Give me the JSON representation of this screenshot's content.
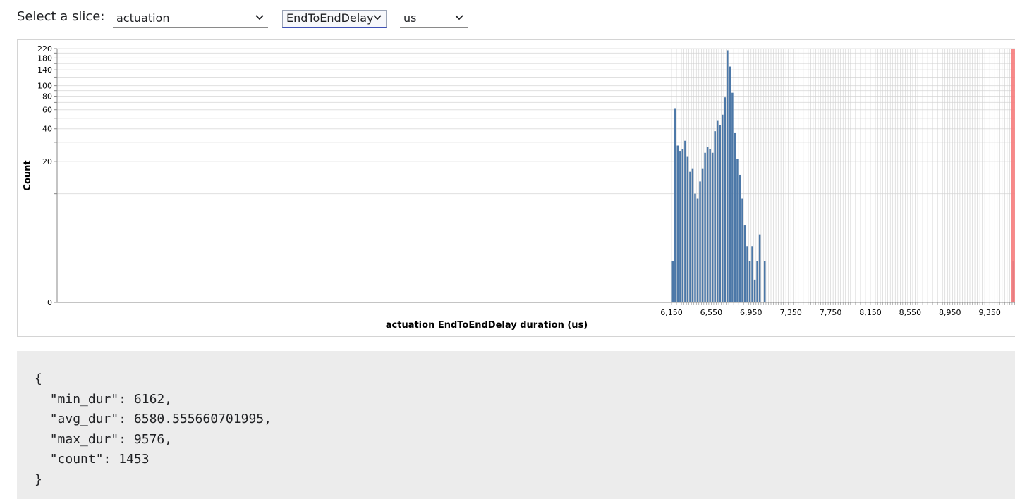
{
  "toolbar": {
    "label": "Select a slice:",
    "slice_select": "actuation",
    "metric_select": "EndToEndDelay",
    "unit_select": "us"
  },
  "stats": {
    "open_brace": "{",
    "lines": [
      "\"min_dur\": 6162,",
      "\"avg_dur\": 6580.555660701995,",
      "\"max_dur\": 9576,",
      "\"count\": 1453"
    ],
    "close_brace": "}"
  },
  "colors": {
    "bar": "#4c78a8",
    "threshold_rule": "#f77c7c",
    "grid": "#e0e0e0",
    "bin_grid": "#cfcfcf"
  },
  "chart_data": {
    "type": "bar",
    "title": "",
    "xlabel": "actuation EndToEndDelay duration (us)",
    "ylabel": "Count",
    "y_scale": "symlog",
    "xlim": [
      6150,
      9600
    ],
    "ylim": [
      0,
      220
    ],
    "x_ticks": [
      "6,150",
      "6,550",
      "6,950",
      "7,350",
      "7,750",
      "8,150",
      "8,550",
      "8,950",
      "9,350"
    ],
    "y_ticks": [
      "0",
      "20",
      "40",
      "60",
      "80",
      "100",
      "140",
      "180",
      "220"
    ],
    "bin_width": 25,
    "bins_start": [
      6150,
      6175,
      6200,
      6225,
      6250,
      6275,
      6300,
      6325,
      6350,
      6375,
      6400,
      6425,
      6450,
      6475,
      6500,
      6525,
      6550,
      6575,
      6600,
      6625,
      6650,
      6675,
      6700,
      6725,
      6750,
      6775,
      6800,
      6825,
      6850,
      6875,
      6900,
      6925,
      6950,
      6975,
      7000,
      7025,
      7050,
      7075,
      9575
    ],
    "counts": [
      2,
      62,
      28,
      25,
      26,
      31,
      22,
      16,
      17,
      10,
      9,
      13,
      17,
      24,
      27,
      26,
      24,
      38,
      48,
      43,
      54,
      78,
      212,
      150,
      86,
      37,
      21,
      15,
      9,
      5,
      3,
      2,
      3,
      1,
      2,
      4,
      0,
      2,
      2
    ],
    "grid": true,
    "threshold_x": 9575,
    "grid_horizontal": true,
    "grid_vertical_per_bin": true,
    "legend": "none"
  }
}
